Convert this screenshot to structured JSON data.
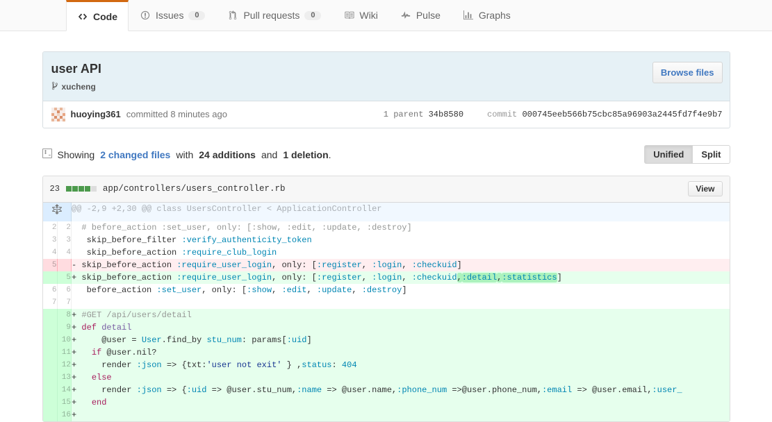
{
  "repo_nav": {
    "tabs": [
      {
        "icon": "code-icon",
        "label": "Code",
        "count": null,
        "selected": true
      },
      {
        "icon": "issue-opened-icon",
        "label": "Issues",
        "count": "0",
        "selected": false
      },
      {
        "icon": "git-pull-request-icon",
        "label": "Pull requests",
        "count": "0",
        "selected": false
      },
      {
        "icon": "book-icon",
        "label": "Wiki",
        "count": null,
        "selected": false
      },
      {
        "icon": "pulse-icon",
        "label": "Pulse",
        "count": null,
        "selected": false
      },
      {
        "icon": "graph-icon",
        "label": "Graphs",
        "count": null,
        "selected": false
      }
    ]
  },
  "commit": {
    "title": "user API",
    "branch_icon": "git-branch-icon",
    "branch": "xucheng",
    "browse_files_label": "Browse files",
    "avatar_icon": "avatar",
    "author": "huoying361",
    "committed_text": "committed 8 minutes ago",
    "parent_count_label": "1 parent",
    "parent_sha": "34b8580",
    "commit_label": "commit",
    "commit_sha": "000745eeb566b75cbc85a96903a2445fd7f4e9b7"
  },
  "toolbar": {
    "diff_icon": "diff-stat-icon",
    "showing_prefix": "Showing",
    "changed_files_link": "2 changed files",
    "with_text": "with",
    "additions": "24 additions",
    "and_text": "and",
    "deletions": "1 deletion",
    "period": ".",
    "unified_label": "Unified",
    "split_label": "Split"
  },
  "file": {
    "changes_count": "23",
    "diffstat_blocks": [
      "add",
      "add",
      "add",
      "add",
      "none"
    ],
    "path": "app/controllers/users_controller.rb",
    "view_label": "View",
    "unfold_icon": "unfold-icon",
    "hunk_header": "@@ -2,9 +2,30 @@ class UsersController < ApplicationController",
    "lines": [
      {
        "type": "ctx",
        "old": "2",
        "new": "2",
        "marker": " ",
        "segments": [
          {
            "t": " # before_action :set_user, only: [:show, :edit, :update, :destroy]",
            "c": "c-com"
          }
        ]
      },
      {
        "type": "ctx",
        "old": "3",
        "new": "3",
        "marker": " ",
        "segments": [
          {
            "t": "  skip_before_filter ",
            "c": ""
          },
          {
            "t": ":verify_authenticity_token",
            "c": "c-sym"
          }
        ]
      },
      {
        "type": "ctx",
        "old": "4",
        "new": "4",
        "marker": " ",
        "segments": [
          {
            "t": "  skip_before_action ",
            "c": ""
          },
          {
            "t": ":require_club_login",
            "c": "c-sym"
          }
        ]
      },
      {
        "type": "del",
        "old": "5",
        "new": "",
        "marker": "-",
        "segments": [
          {
            "t": " skip_before_action ",
            "c": ""
          },
          {
            "t": ":require_user_login",
            "c": "c-sym"
          },
          {
            "t": ", only: [",
            "c": ""
          },
          {
            "t": ":register",
            "c": "c-sym"
          },
          {
            "t": ", ",
            "c": ""
          },
          {
            "t": ":login",
            "c": "c-sym"
          },
          {
            "t": ", ",
            "c": ""
          },
          {
            "t": ":checkuid",
            "c": "c-sym"
          },
          {
            "t": "]",
            "c": ""
          }
        ]
      },
      {
        "type": "add",
        "old": "",
        "new": "5",
        "marker": "+",
        "segments": [
          {
            "t": " skip_before_action ",
            "c": ""
          },
          {
            "t": ":require_user_login",
            "c": "c-sym"
          },
          {
            "t": ", only: [",
            "c": ""
          },
          {
            "t": ":register",
            "c": "c-sym"
          },
          {
            "t": ", ",
            "c": ""
          },
          {
            "t": ":login",
            "c": "c-sym"
          },
          {
            "t": ", ",
            "c": ""
          },
          {
            "t": ":checkuid",
            "c": "c-sym"
          },
          {
            "t": ",",
            "c": "wh"
          },
          {
            "t": ":detail",
            "c": "wh c-sym"
          },
          {
            "t": ",",
            "c": "wh"
          },
          {
            "t": ":statistics",
            "c": "wh c-sym"
          },
          {
            "t": "]",
            "c": ""
          }
        ]
      },
      {
        "type": "ctx",
        "old": "6",
        "new": "6",
        "marker": " ",
        "segments": [
          {
            "t": "  before_action ",
            "c": ""
          },
          {
            "t": ":set_user",
            "c": "c-sym"
          },
          {
            "t": ", only: [",
            "c": ""
          },
          {
            "t": ":show",
            "c": "c-sym"
          },
          {
            "t": ", ",
            "c": ""
          },
          {
            "t": ":edit",
            "c": "c-sym"
          },
          {
            "t": ", ",
            "c": ""
          },
          {
            "t": ":update",
            "c": "c-sym"
          },
          {
            "t": ", ",
            "c": ""
          },
          {
            "t": ":destroy",
            "c": "c-sym"
          },
          {
            "t": "]",
            "c": ""
          }
        ]
      },
      {
        "type": "ctx",
        "old": "7",
        "new": "7",
        "marker": " ",
        "segments": [
          {
            "t": "",
            "c": ""
          }
        ]
      },
      {
        "type": "add",
        "old": "",
        "new": "8",
        "marker": "+",
        "segments": [
          {
            "t": " #GET /api/users/detail",
            "c": "c-com"
          }
        ]
      },
      {
        "type": "add",
        "old": "",
        "new": "9",
        "marker": "+",
        "segments": [
          {
            "t": " ",
            "c": ""
          },
          {
            "t": "def",
            "c": "c-kw"
          },
          {
            "t": " ",
            "c": ""
          },
          {
            "t": "detail",
            "c": "c-meth"
          }
        ]
      },
      {
        "type": "add",
        "old": "",
        "new": "10",
        "marker": "+",
        "segments": [
          {
            "t": "     @user = ",
            "c": ""
          },
          {
            "t": "User",
            "c": "c-const"
          },
          {
            "t": ".find_by ",
            "c": ""
          },
          {
            "t": "stu_num",
            "c": "c-sym"
          },
          {
            "t": ": params[",
            "c": ""
          },
          {
            "t": ":uid",
            "c": "c-sym"
          },
          {
            "t": "]",
            "c": ""
          }
        ]
      },
      {
        "type": "add",
        "old": "",
        "new": "11",
        "marker": "+",
        "segments": [
          {
            "t": "   ",
            "c": ""
          },
          {
            "t": "if",
            "c": "c-kw"
          },
          {
            "t": " @user.nil?",
            "c": ""
          }
        ]
      },
      {
        "type": "add",
        "old": "",
        "new": "12",
        "marker": "+",
        "segments": [
          {
            "t": "     render ",
            "c": ""
          },
          {
            "t": ":json",
            "c": "c-sym"
          },
          {
            "t": " => {txt:",
            "c": ""
          },
          {
            "t": "'user not exit'",
            "c": "c-str"
          },
          {
            "t": " } ,",
            "c": ""
          },
          {
            "t": "status",
            "c": "c-sym"
          },
          {
            "t": ": ",
            "c": ""
          },
          {
            "t": "404",
            "c": "c-num"
          }
        ]
      },
      {
        "type": "add",
        "old": "",
        "new": "13",
        "marker": "+",
        "segments": [
          {
            "t": "   ",
            "c": ""
          },
          {
            "t": "else",
            "c": "c-kw"
          }
        ]
      },
      {
        "type": "add",
        "old": "",
        "new": "14",
        "marker": "+",
        "segments": [
          {
            "t": "     render ",
            "c": ""
          },
          {
            "t": ":json",
            "c": "c-sym"
          },
          {
            "t": " => {",
            "c": ""
          },
          {
            "t": ":uid",
            "c": "c-sym"
          },
          {
            "t": " => @user.stu_num,",
            "c": ""
          },
          {
            "t": ":name",
            "c": "c-sym"
          },
          {
            "t": " => @user.name,",
            "c": ""
          },
          {
            "t": ":phone_num",
            "c": "c-sym"
          },
          {
            "t": " =>@user.phone_num,",
            "c": ""
          },
          {
            "t": ":email",
            "c": "c-sym"
          },
          {
            "t": " => @user.email,",
            "c": ""
          },
          {
            "t": ":user_",
            "c": "c-sym"
          }
        ]
      },
      {
        "type": "add",
        "old": "",
        "new": "15",
        "marker": "+",
        "segments": [
          {
            "t": "   ",
            "c": ""
          },
          {
            "t": "end",
            "c": "c-kw"
          }
        ]
      },
      {
        "type": "add",
        "old": "",
        "new": "16",
        "marker": "+",
        "segments": [
          {
            "t": "",
            "c": ""
          }
        ]
      }
    ]
  },
  "colors": {
    "accent_orange": "#d26911",
    "link_blue": "#4078c0",
    "add_bg": "#e6ffed",
    "del_bg": "#ffeef0",
    "hunk_bg": "#f1f8ff",
    "commit_header_bg": "#e6f1f6",
    "word_highlight": "#acf2bd"
  }
}
